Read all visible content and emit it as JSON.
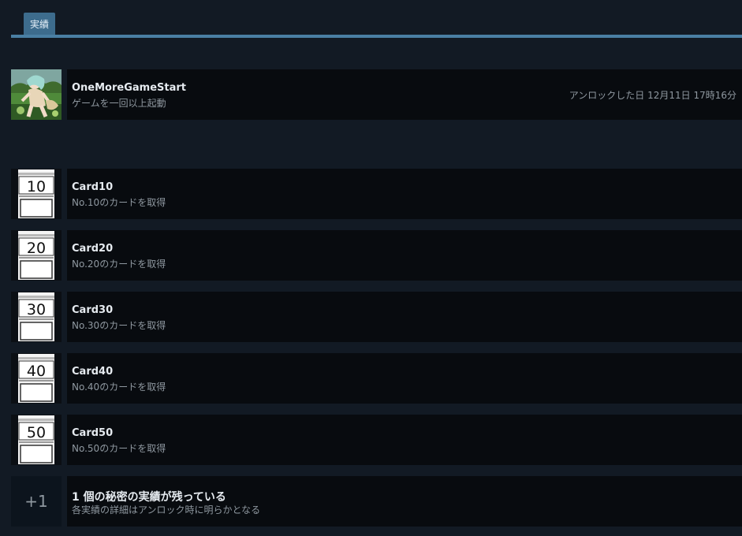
{
  "tabs": [
    {
      "label": "実績"
    }
  ],
  "unlocked": [
    {
      "name": "OneMoreGameStart",
      "desc": "ゲームを一回以上起動",
      "unlock_text": "アンロックした日 12月11日 17時16分"
    }
  ],
  "locked": [
    {
      "icon_number": "10",
      "name": "Card10",
      "desc": "No.10のカードを取得"
    },
    {
      "icon_number": "20",
      "name": "Card20",
      "desc": "No.20のカードを取得"
    },
    {
      "icon_number": "30",
      "name": "Card30",
      "desc": "No.30のカードを取得"
    },
    {
      "icon_number": "40",
      "name": "Card40",
      "desc": "No.40のカードを取得"
    },
    {
      "icon_number": "50",
      "name": "Card50",
      "desc": "No.50のカードを取得"
    }
  ],
  "hidden": {
    "count_label": "+1",
    "title": "1 個の秘密の実績が残っている",
    "desc": "各実績の詳細はアンロック時に明らかとなる"
  },
  "colors": {
    "background": "#121a24",
    "accent_tab": "#3d6c8d",
    "row_background": "#080b0f"
  }
}
